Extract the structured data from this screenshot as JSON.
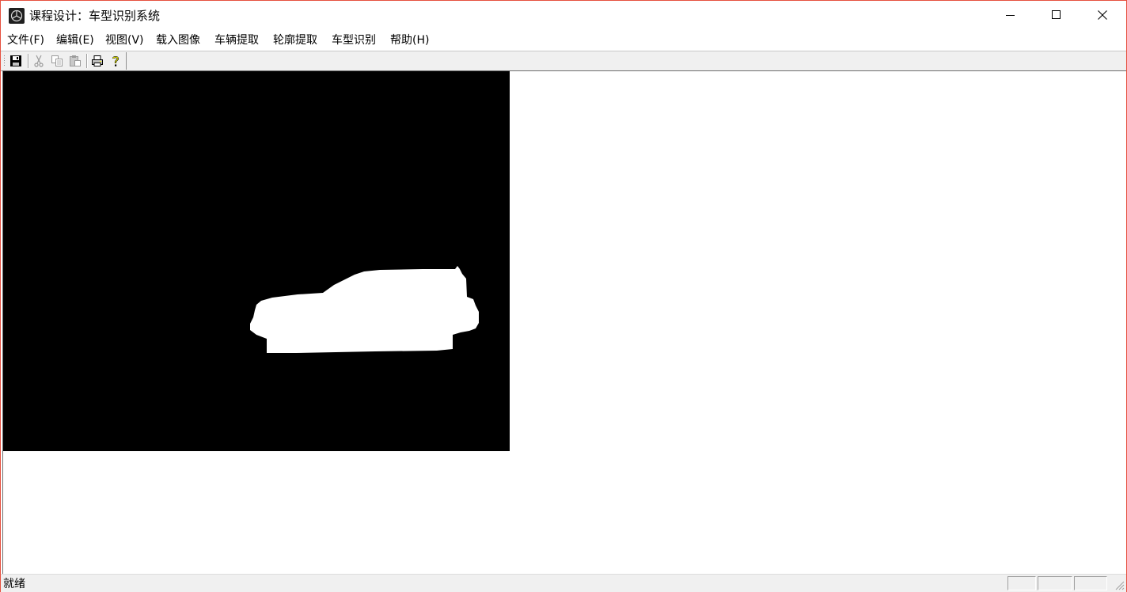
{
  "window": {
    "title": "课程设计：车型识别系统",
    "icon": "mercedes-logo-icon",
    "buttons": [
      "minimize-icon",
      "maximize-icon",
      "close-icon"
    ]
  },
  "menu": {
    "items": [
      "文件(F)",
      "编辑(E)",
      "视图(V)",
      "载入图像",
      "车辆提取",
      "轮廓提取",
      "车型识别",
      "帮助(H)"
    ]
  },
  "toolbar": {
    "buttons": [
      {
        "icon": "save-icon",
        "enabled": true
      },
      {
        "icon": "cut-icon",
        "enabled": false
      },
      {
        "icon": "copy-icon",
        "enabled": false
      },
      {
        "icon": "paste-icon",
        "enabled": false
      },
      {
        "icon": "print-icon",
        "enabled": true
      },
      {
        "icon": "help-icon",
        "enabled": true
      }
    ]
  },
  "canvas": {
    "content": "binary-vehicle-mask",
    "background": "#000000",
    "foreground": "#ffffff"
  },
  "status": {
    "text": "就绪"
  },
  "colors": {
    "window_border": "#e6503f",
    "chrome": "#f0f0f0"
  }
}
